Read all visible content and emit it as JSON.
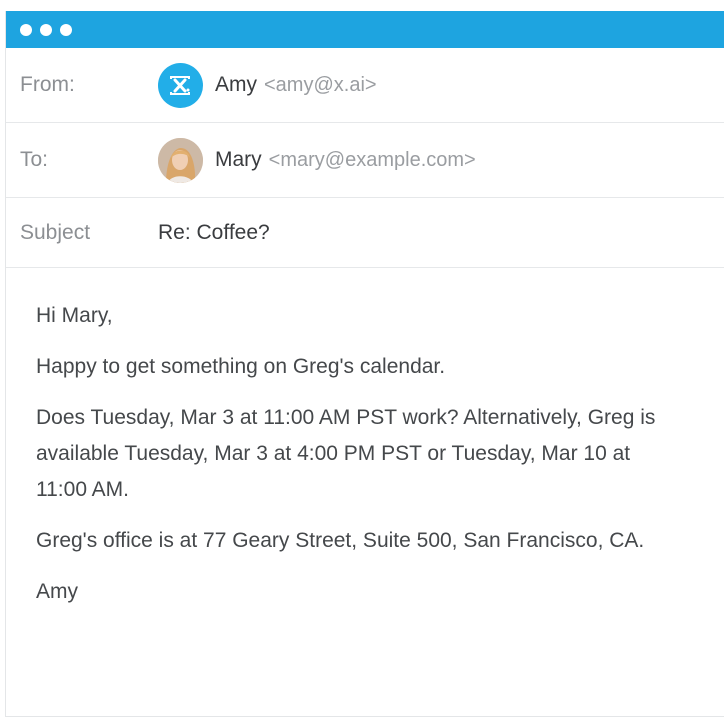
{
  "window": {
    "titlebar_color": "#1ea4e0",
    "controls": [
      "dot",
      "dot",
      "dot"
    ]
  },
  "header": {
    "from": {
      "label": "From:",
      "name": "Amy",
      "email": "<amy@x.ai>",
      "avatar": "x-ai-logo-icon"
    },
    "to": {
      "label": "To:",
      "name": "Mary",
      "email": "<mary@example.com>",
      "avatar": "user-photo"
    },
    "subject": {
      "label": "Subject",
      "value": "Re: Coffee?"
    }
  },
  "body": {
    "greeting": "Hi Mary,",
    "p1": "Happy to get something on Greg's calendar.",
    "p2": "Does Tuesday, Mar 3 at 11:00 AM PST work? Alternatively, Greg is available Tuesday, Mar 3 at 4:00 PM PST or Tuesday, Mar 10 at 11:00 AM.",
    "p3": "Greg's office is at 77 Geary Street, Suite 500, San Francisco, CA.",
    "signature": "Amy"
  }
}
